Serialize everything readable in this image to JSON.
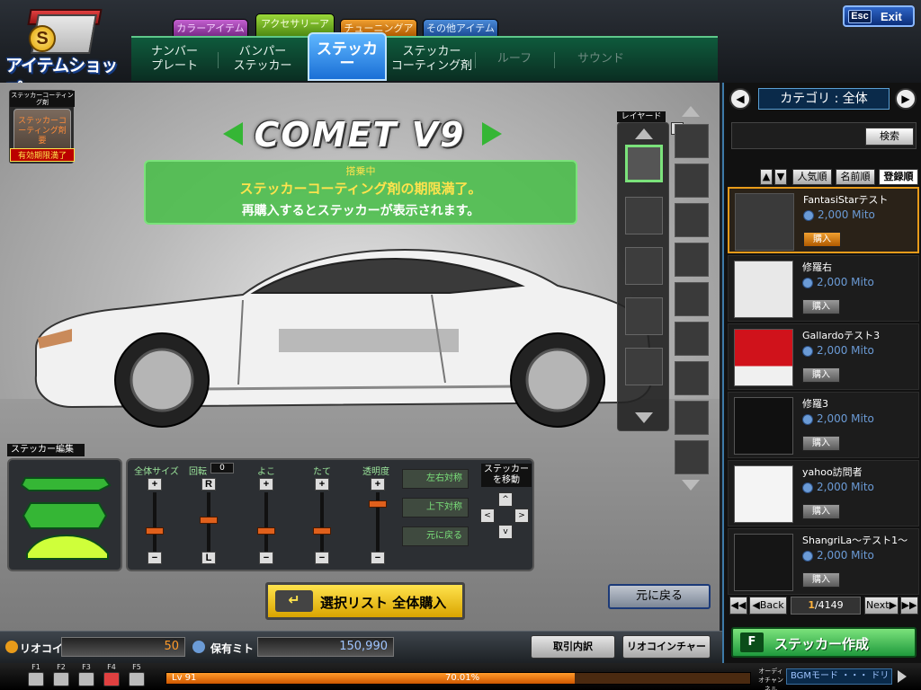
{
  "logo": {
    "badge": "S",
    "title": "アイテムショップ"
  },
  "category_tabs": [
    "カラーアイテム",
    "アクセサリーアイテム",
    "チューニングアイテム",
    "その他アイテム"
  ],
  "sub_tabs": [
    "ナンバー\nプレート",
    "バンパー\nステッカー",
    "ステッカー",
    "ステッカー\nコーティング剤",
    "ルーフ",
    "サウンド"
  ],
  "exit": {
    "key": "Esc",
    "label": "Exit"
  },
  "coating_card": {
    "caption": "ステッカーコーティング剤",
    "text": "ステッカーコーティング剤要",
    "expired": "有効期限満了"
  },
  "car": {
    "name": "COMET V9"
  },
  "notice": {
    "tag": "搭乗中",
    "line1": "ステッカーコーティング剤の期限満了。",
    "line2": "再購入するとステッカーが表示されます。"
  },
  "layers": {
    "title": "レイヤード",
    "close": "×"
  },
  "edit": {
    "title": "ステッカー編集",
    "labels": {
      "size": "全体サイズ",
      "rotate": "回転",
      "horizontal": "よこ",
      "vertical": "たて",
      "opacity": "透明度"
    },
    "rotate_value": "0",
    "rotate_top": "R",
    "rotate_bottom": "L",
    "plus": "+",
    "minus": "−",
    "slider_levels": {
      "size": 0.35,
      "rotate": 0.55,
      "horizontal": 0.35,
      "vertical": 0.35,
      "opacity": 0.85
    },
    "mirror_h": "左右対称",
    "mirror_v": "上下対称",
    "reset": "元に戻る",
    "move_label": "ステッカー\nを移動",
    "dpad": {
      "up": "^",
      "down": "v",
      "left": "<",
      "right": ">"
    }
  },
  "buy_btn": {
    "icon": "↵",
    "label": "選択リスト 全体購入"
  },
  "revert_btn": "元に戻る",
  "right": {
    "category": "カテゴリ : 全体",
    "search_btn": "検索",
    "sort": [
      "人気順",
      "名前順",
      "登録順"
    ],
    "items": [
      {
        "name": "FantasiStarテスト",
        "price": "2,000 Mito",
        "button": "購入"
      },
      {
        "name": "修羅右",
        "price": "2,000 Mito",
        "button": "購入"
      },
      {
        "name": "Gallardoテスト3",
        "price": "2,000 Mito",
        "button": "購入"
      },
      {
        "name": "修羅3",
        "price": "2,000 Mito",
        "button": "購入"
      },
      {
        "name": "yahoo訪問者",
        "price": "2,000 Mito",
        "button": "購入"
      },
      {
        "name": "ShangriLa〜テスト1〜",
        "price": "2,000 Mito",
        "button": "購入"
      }
    ],
    "pager": {
      "first": "◀◀",
      "back": "◀Back",
      "current": "1",
      "total": "/4149",
      "next": "Next▶",
      "last": "▶▶"
    },
    "create": {
      "key": "F",
      "label": "ステッカー作成"
    }
  },
  "bottom": {
    "rio_label": "リオコイン",
    "rio_value": "50",
    "mito_label": "保有ミト",
    "mito_value": "150,990",
    "history_btn": "取引内訳",
    "charge_btn": "リオコインチャージ"
  },
  "status": {
    "fkeys": [
      "F1",
      "F2",
      "F3",
      "F4",
      "F5"
    ],
    "level": "Lv 91",
    "percent": "70.01%",
    "progress": 0.7001,
    "bgm_label": "オーディオチャンネル",
    "bgm_text": "BGMモード ・・・ ドリ"
  },
  "colors": {
    "accent_green": "#35b635",
    "tab_blue": "#1a6fd6",
    "price_blue": "#6b9bd6",
    "select_orange": "#e89b1a"
  }
}
